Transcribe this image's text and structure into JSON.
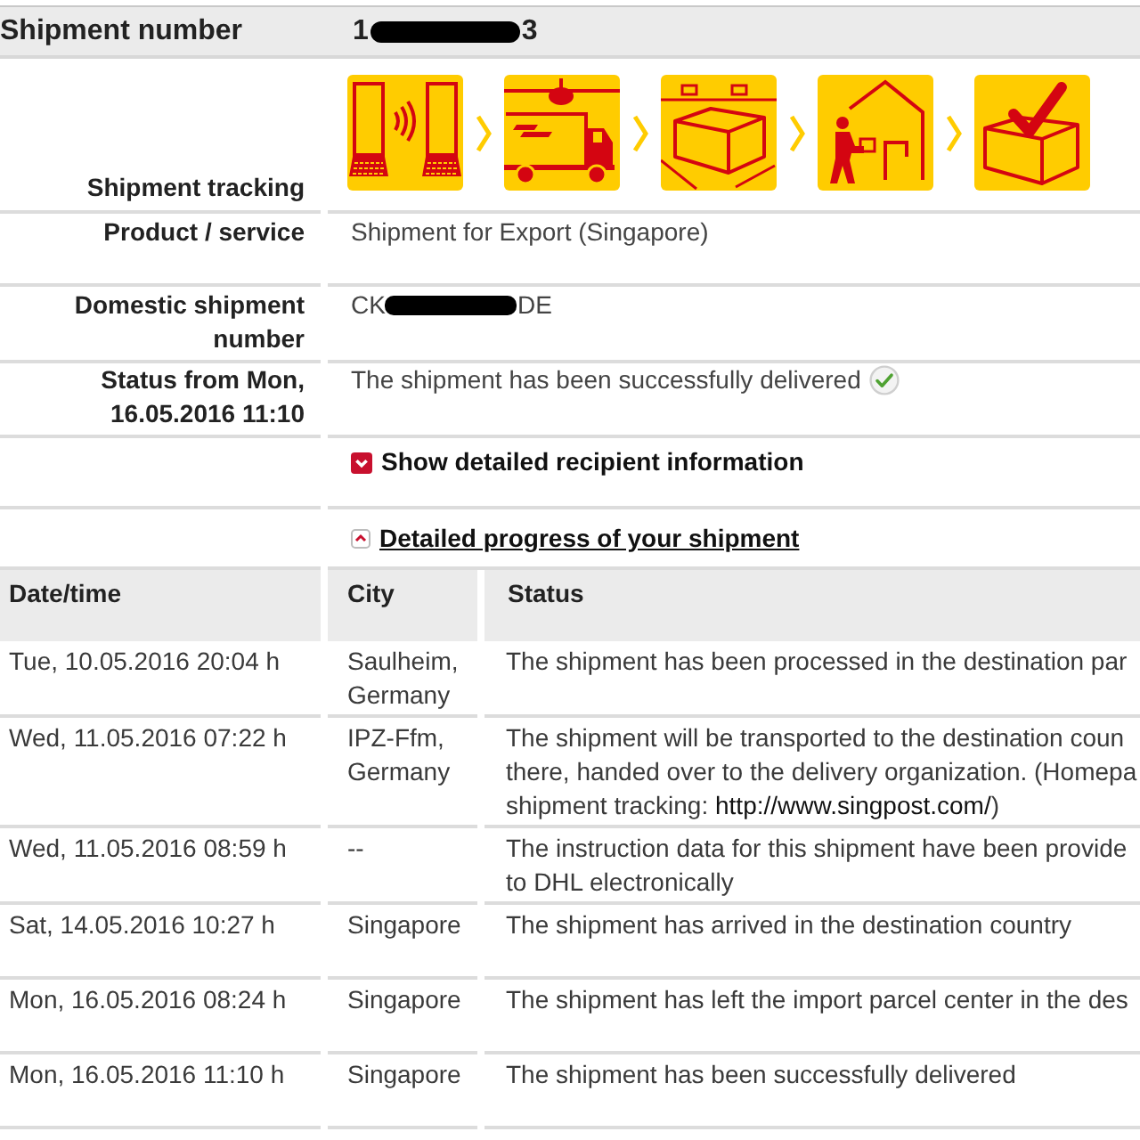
{
  "shipment_number": {
    "label": "Shipment number",
    "value_start": "1",
    "value_end": "3",
    "redacted": true
  },
  "tracking": {
    "label": "Shipment tracking",
    "steps": [
      {
        "kind": "notice",
        "completed": true
      },
      {
        "kind": "transport",
        "completed": true
      },
      {
        "kind": "hub",
        "completed": true
      },
      {
        "kind": "delivery",
        "completed": true
      },
      {
        "kind": "delivered",
        "completed": true
      }
    ]
  },
  "details": [
    {
      "label": "Product / service",
      "value": "Shipment for Export (Singapore)"
    },
    {
      "label": "Domestic shipment number",
      "value_start": "CK",
      "value_end": "DE",
      "redacted": true
    },
    {
      "label": "Status from Mon, 16.05.2016 11:10",
      "value": "The shipment has been successfully delivered",
      "delivered": true
    }
  ],
  "toggles": [
    {
      "label": "Show detailed recipient information",
      "expanded": false
    },
    {
      "label": "Detailed progress of your shipment",
      "expanded": true
    }
  ],
  "events": {
    "columns": [
      "Date/time",
      "City",
      "Status"
    ],
    "rows": [
      {
        "date": "Tue, 10.05.2016 20:04 h",
        "city": "Saulheim, Germany",
        "status_lines": [
          "The shipment has been processed in the destination par"
        ]
      },
      {
        "date": "Wed, 11.05.2016 07:22 h",
        "city": "IPZ-Ffm, Germany",
        "status_lines": [
          "The shipment will be transported to the destination coun",
          "there, handed over to the delivery organization. (Homepa",
          "shipment tracking: "
        ],
        "link": "http://www.singpost.com/",
        "after_link": ")"
      },
      {
        "date": "Wed, 11.05.2016 08:59 h",
        "city": "--",
        "status_lines": [
          "The instruction data for this shipment have been provide",
          "to DHL electronically"
        ]
      },
      {
        "date": "Sat, 14.05.2016 10:27 h",
        "city": "Singapore",
        "status_lines": [
          "The shipment has arrived in the destination country"
        ]
      },
      {
        "date": "Mon, 16.05.2016 08:24 h",
        "city": "Singapore",
        "status_lines": [
          "The shipment has left the import parcel center in the des"
        ]
      },
      {
        "date": "Mon, 16.05.2016 11:10 h",
        "city": "Singapore",
        "status_lines": [
          "The shipment has been successfully delivered"
        ]
      }
    ]
  }
}
